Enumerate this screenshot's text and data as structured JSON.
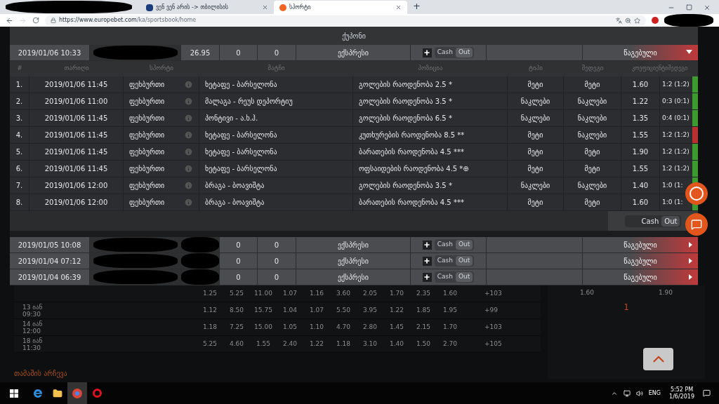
{
  "browser": {
    "tabs": [
      {
        "title": "ვენ ვენ არის -> თბილისის",
        "selected": false
      },
      {
        "title": "სპორტი",
        "selected": true
      }
    ],
    "new_tab": "+",
    "url_host": "https://www.europebet.com",
    "url_path": "/ka/sportsbook/home"
  },
  "coupon_panel": {
    "title": "ქუპონი",
    "coupons": [
      {
        "date": "2019/01/06 10:33",
        "amount": "26.95",
        "col_4": "0",
        "col_5": "0",
        "type": "ექსპრესი",
        "cash": "Cash",
        "out": "Out",
        "status": "წაგებული",
        "expanded": true
      },
      {
        "date": "2019/01/05 10:08",
        "col_4": "0",
        "col_5": "0",
        "type": "ექსპრესი",
        "cash": "Cash",
        "out": "Out",
        "status": "წაგებული",
        "expanded": false
      },
      {
        "date": "2019/01/04 07:12",
        "col_4": "0",
        "col_5": "0",
        "type": "ექსპრესი",
        "cash": "Cash",
        "out": "Out",
        "status": "წაგებული",
        "expanded": false
      },
      {
        "date": "2019/01/04 06:39",
        "col_4": "0",
        "col_5": "0",
        "type": "ექსპრესი",
        "cash": "Cash",
        "out": "Out",
        "status": "წაგებული",
        "expanded": false
      }
    ],
    "bet_columns": [
      "#",
      "თარიღი",
      "სპორტი",
      "მატჩი",
      "პოზიცია",
      "ტიპი",
      "შედეგი",
      "კოეფიციენტიშედეგი"
    ],
    "bets": [
      {
        "n": "1.",
        "date": "2019/01/06 11:45",
        "sport": "ფეხბურთი",
        "match": "ხეტაფე - ბარსელონა",
        "position": "გოლების რაოდენობა 2.5 *",
        "type": "მეტი",
        "result": "მეტი",
        "odds": "1.60",
        "score": "1:2 (1:2)",
        "color": "#3c9a2e"
      },
      {
        "n": "2.",
        "date": "2019/01/06 11:00",
        "sport": "ფეხბურთი",
        "match": "მალაგა - რეუს დეპორტიუ",
        "position": "გოლების რაოდენობა 3.5 *",
        "type": "ნაკლები",
        "result": "ნაკლები",
        "odds": "1.22",
        "score": "0:3 (0:1)",
        "color": "#3c9a2e"
      },
      {
        "n": "3.",
        "date": "2019/01/06 11:45",
        "sport": "ფეხბურთი",
        "match": "პონტივი - ა.ხ.ჰ.",
        "position": "გოლების რაოდენობა 6.5 *",
        "type": "ნაკლები",
        "result": "ნაკლები",
        "odds": "1.35",
        "score": "0:4 (0:1)",
        "color": "#3c9a2e"
      },
      {
        "n": "4.",
        "date": "2019/01/06 11:45",
        "sport": "ფეხბურთი",
        "match": "ხეტაფე - ბარსელონა",
        "position": "კუთხურების რაოდენობა 8.5 **",
        "type": "მეტი",
        "result": "ნაკლები",
        "odds": "1.55",
        "score": "1:2 (1:2)",
        "color": "#b8302f"
      },
      {
        "n": "5.",
        "date": "2019/01/06 11:45",
        "sport": "ფეხბურთი",
        "match": "ხეტაფე - ბარსელონა",
        "position": "ბარათების რაოდენობა 4.5 ***",
        "type": "მეტი",
        "result": "მეტი",
        "odds": "1.90",
        "score": "1:2 (1:2)",
        "color": "#3c9a2e"
      },
      {
        "n": "6.",
        "date": "2019/01/06 11:45",
        "sport": "ფეხბურთი",
        "match": "ხეტაფე - ბარსელონა",
        "position": "ოფსაიდების რაოდენობა 4.5  *⊕",
        "type": "მეტი",
        "result": "მეტი",
        "odds": "1.55",
        "score": "1:2 (1:2)",
        "color": "#3c9a2e"
      },
      {
        "n": "7.",
        "date": "2019/01/06 12:00",
        "sport": "ფეხბურთი",
        "match": "ბრაგა - ბოავიშტა",
        "position": "გოლების რაოდენობა 3.5 *",
        "type": "ნაკლები",
        "result": "ნაკლები",
        "odds": "1.40",
        "score": "1:0 (1:",
        "color": "#3c9a2e"
      },
      {
        "n": "8.",
        "date": "2019/01/06 12:00",
        "sport": "ფეხბურთი",
        "match": "ბრაგა - ბოავიშტა",
        "position": "ბარათების რაოდენობა 4.5 ***",
        "type": "მეტი",
        "result": "მეტი",
        "odds": "1.60",
        "score": "1:0 (1:",
        "color": "#3c9a2e"
      }
    ],
    "footer_cash": "Cash",
    "footer_out": "Out"
  },
  "background": {
    "rows": [
      {
        "date": "13 იან",
        "time": "09:30",
        "odds": [
          "1.12",
          "8.50",
          "15.75",
          "1.04",
          "1.07",
          "5.50",
          "3.95",
          "1.22",
          "1.85",
          "1.95"
        ],
        "more": "+99"
      },
      {
        "date": "14 იან",
        "time": "12:00",
        "odds": [
          "1.18",
          "7.25",
          "15.00",
          "1.05",
          "1.10",
          "4.70",
          "2.80",
          "1.45",
          "2.15",
          "1.70"
        ],
        "more": "+103"
      },
      {
        "date": "18 იან",
        "time": "11:30",
        "odds": [
          "5.25",
          "4.60",
          "1.55",
          "2.40",
          "1.22",
          "1.18",
          "3.10",
          "1.40",
          "1.50",
          "2.70"
        ],
        "more": "+105"
      }
    ],
    "top_row": {
      "odds": [
        "1.25",
        "5.25",
        "11.00",
        "1.07",
        "1.16",
        "3.60",
        "2.05",
        "1.70",
        "2.35",
        "1.60"
      ],
      "more": "+103"
    },
    "section_title": "თამაშის არჩევა",
    "side_odds": [
      "1.60",
      "1.90"
    ],
    "side_count": "1"
  },
  "taskbar": {
    "language": "ENG",
    "time": "5:52 PM",
    "date": "1/6/2019"
  }
}
